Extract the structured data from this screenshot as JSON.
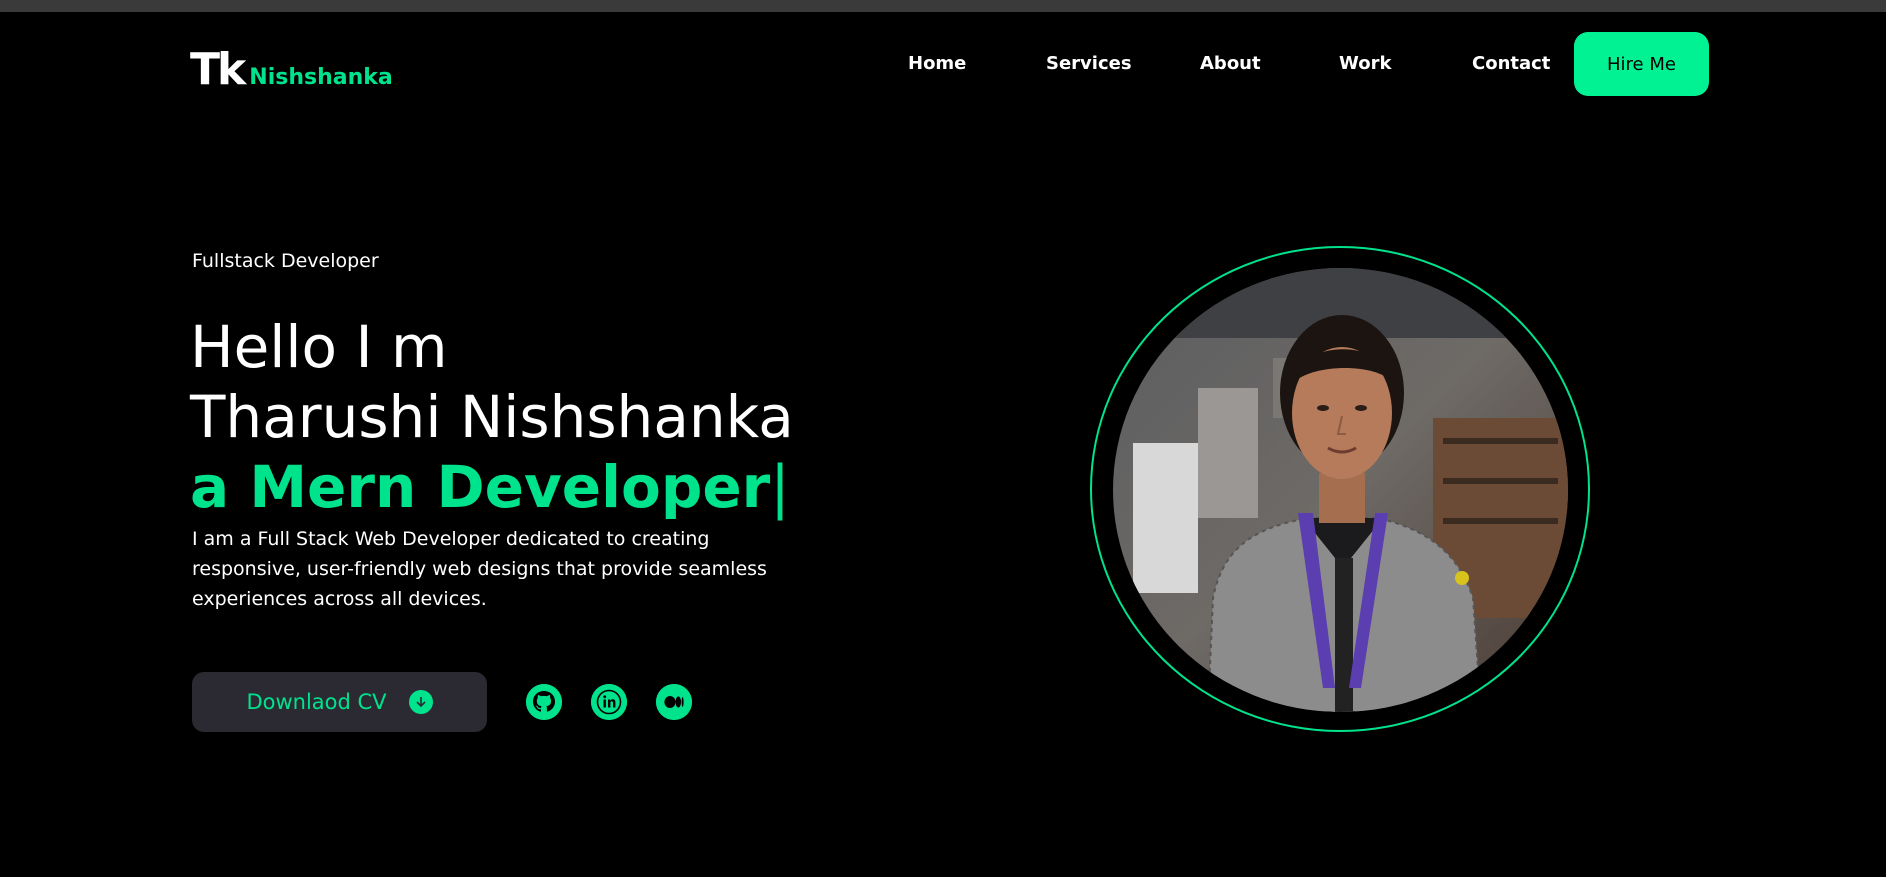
{
  "header": {
    "logo_mark": "Tk",
    "logo_name": "Nishshanka",
    "nav": [
      "Home",
      "Services",
      "About",
      "Work",
      "Contact"
    ],
    "hire_label": "Hire Me"
  },
  "hero": {
    "role": "Fullstack Developer",
    "greeting": "Hello I m",
    "name": "Tharushi Nishshanka",
    "typed_text": "a Mern Developer",
    "caret": "|",
    "description": "I am a Full Stack Web Developer dedicated to creating responsive, user-friendly web designs that provide seamless experiences across all devices.",
    "cv_label": "Downlaod CV",
    "socials": [
      "github-icon",
      "linkedin-icon",
      "medium-icon"
    ]
  },
  "colors": {
    "accent": "#00e38d",
    "button_accent": "#00f293",
    "background": "#000000",
    "cv_button_bg": "#2b2a33"
  }
}
